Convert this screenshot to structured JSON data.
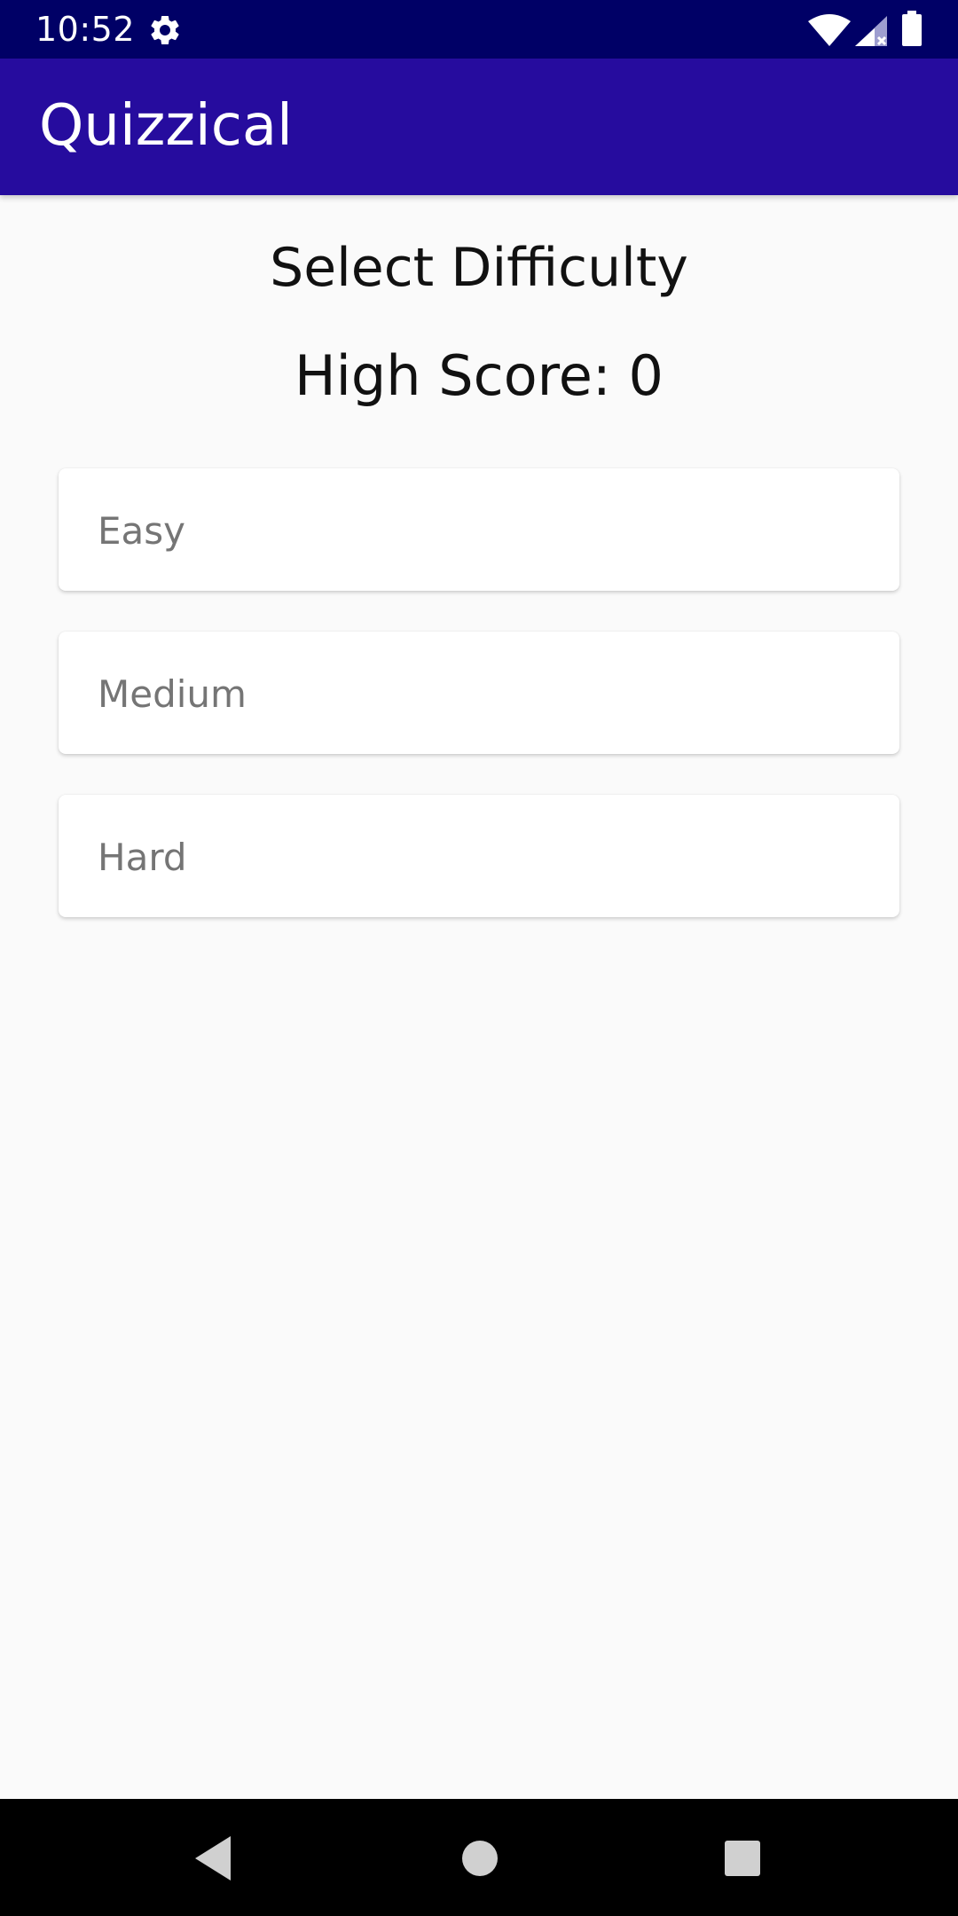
{
  "status_bar": {
    "time": "10:52",
    "icons": [
      "gear-icon",
      "wifi-icon",
      "signal-icon",
      "battery-icon"
    ],
    "color": "#000066"
  },
  "app_bar": {
    "title": "Quizzical",
    "color": "#260c9e"
  },
  "main": {
    "heading": "Select Difficulty",
    "high_score": "High Score: 0",
    "options": [
      {
        "label": "Easy"
      },
      {
        "label": "Medium"
      },
      {
        "label": "Hard"
      }
    ]
  },
  "navigation": {
    "buttons": [
      "back-icon",
      "home-icon",
      "recents-icon"
    ]
  }
}
